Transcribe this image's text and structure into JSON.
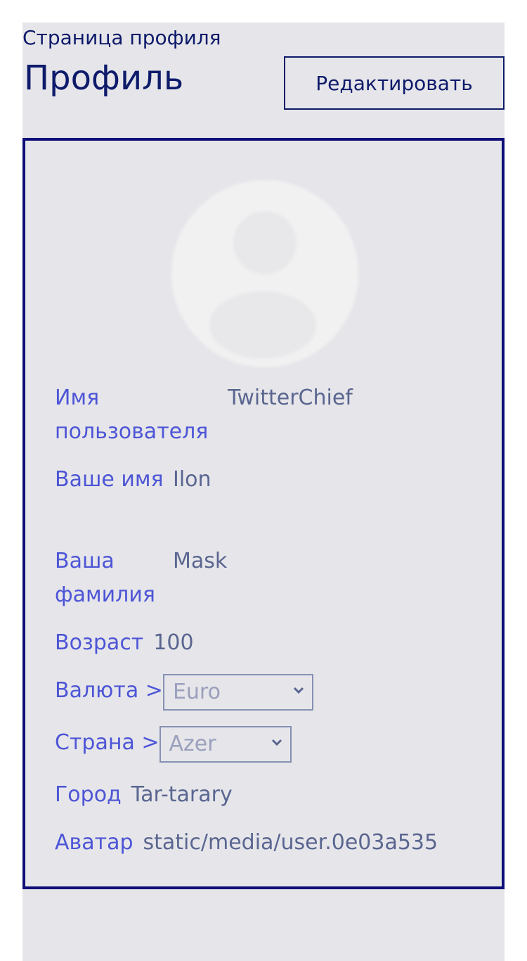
{
  "header": {
    "breadcrumb": "Страница профиля",
    "title": "Профиль",
    "edit_label": "Редактировать"
  },
  "profile": {
    "avatar_icon": "user-silhouette-icon",
    "username_label": "Имя пользователя",
    "username_value": "TwitterChief",
    "first_name_label": "Ваше имя",
    "first_name_value": "Ilon",
    "last_name_label": "Ваша фамилия",
    "last_name_value": "Mask",
    "age_label": "Возраст",
    "age_value": "100",
    "currency_label": "Валюта >",
    "currency_selected": "Euro",
    "country_label": "Страна >",
    "country_selected": "Azer",
    "city_label": "Город",
    "city_value": "Tar-tarary",
    "avatar_label": "Аватар",
    "avatar_value": "static/media/user.0e03a535"
  },
  "colors": {
    "title": "#0e1a6a",
    "border": "#0e0e78",
    "label": "#4d55d6",
    "value": "#5a6690",
    "background": "#e6e6ea"
  }
}
